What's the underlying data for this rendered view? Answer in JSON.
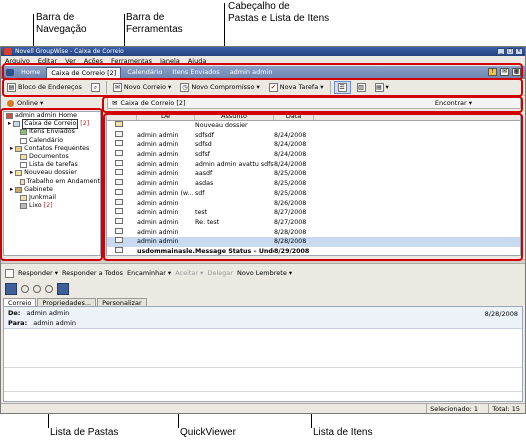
{
  "callouts": {
    "nav_bar": "Barra de\nNavegação",
    "toolbar": "Barra de\nFerramentas",
    "header": "Cabeçalho de\nPastas e Lista de Itens",
    "folder_list": "Lista de Pastas",
    "quickviewer": "QuickViewer",
    "item_list": "Lista de Itens"
  },
  "window": {
    "title": "Novell GroupWise - Caixa de Correio"
  },
  "menu": [
    "Arquivo",
    "Editar",
    "Ver",
    "Ações",
    "Ferramentas",
    "Janela",
    "Ajuda"
  ],
  "nav_tabs": [
    {
      "label": "Home",
      "active": false
    },
    {
      "label": "Caixa de Correio [2]",
      "active": true
    },
    {
      "label": "Calendário",
      "active": false
    },
    {
      "label": "Itens Enviados",
      "active": false
    },
    {
      "label": "admin admin",
      "active": false
    }
  ],
  "toolbar": {
    "address_book": "Bloco de Endereços",
    "new_mail": "Novo Correio ▾",
    "new_appointment": "Novo Compromisso ▾",
    "new_task": "Nova Tarefa ▾"
  },
  "location": {
    "online": "Online ▾",
    "breadcrumb": "Caixa de Correio [2]",
    "find": "Encontrar ▾"
  },
  "folders": [
    {
      "label": "admin admin Home",
      "indent": 0,
      "count": ""
    },
    {
      "label": "Caixa de Correio",
      "indent": 1,
      "count": "[2]",
      "selected": true
    },
    {
      "label": "Itens Enviados",
      "indent": 2,
      "count": ""
    },
    {
      "label": "Calendário",
      "indent": 2,
      "count": ""
    },
    {
      "label": "Contatos Frequentes",
      "indent": 2,
      "count": ""
    },
    {
      "label": "Documentos",
      "indent": 2,
      "count": ""
    },
    {
      "label": "Lista de tarefas",
      "indent": 2,
      "count": ""
    },
    {
      "label": "Nouveau dossier",
      "indent": 2,
      "count": ""
    },
    {
      "label": "Trabalho em Andament",
      "indent": 2,
      "count": ""
    },
    {
      "label": "Gabinete",
      "indent": 2,
      "count": ""
    },
    {
      "label": "Junkmail",
      "indent": 2,
      "count": ""
    },
    {
      "label": "Lixo",
      "indent": 2,
      "count": "[2]"
    }
  ],
  "list": {
    "headers": {
      "from": "De",
      "subject": "Assunto",
      "date": "Data"
    },
    "rows": [
      {
        "from": "",
        "subject": "Nouveau dossier",
        "date": ""
      },
      {
        "from": "admin admin",
        "subject": "sdfsdf",
        "date": "8/24/2008"
      },
      {
        "from": "admin admin",
        "subject": "sdfsd",
        "date": "8/24/2008"
      },
      {
        "from": "admin admin",
        "subject": "sdfsf",
        "date": "8/24/2008"
      },
      {
        "from": "admin admin",
        "subject": "admin admin avattu sdfsf",
        "date": "8/24/2008"
      },
      {
        "from": "admin admin",
        "subject": "aasdf",
        "date": "8/25/2008"
      },
      {
        "from": "admin admin",
        "subject": "asdas",
        "date": "8/25/2008"
      },
      {
        "from": "admin admin (w...",
        "subject": "sdf",
        "date": "8/25/2008"
      },
      {
        "from": "admin admin",
        "subject": "",
        "date": "8/26/2008"
      },
      {
        "from": "admin admin",
        "subject": "test",
        "date": "8/27/2008"
      },
      {
        "from": "admin admin",
        "subject": "Re: test",
        "date": "8/27/2008"
      },
      {
        "from": "admin admin",
        "subject": "",
        "date": "8/28/2008"
      },
      {
        "from": "admin admin",
        "subject": "",
        "date": "8/28/2008",
        "selected": true
      },
      {
        "from": "usdommainasle...",
        "subject": "Message Status – Undeli...",
        "date": "8/29/2008",
        "bold": true
      }
    ]
  },
  "quickviewer_toolbar": {
    "reply": "Responder ▾",
    "reply_all": "Responder a Todos",
    "forward": "Encaminhar ▾",
    "accept": "Aceitar ▾",
    "delegate": "Delegar",
    "new_reminder": "Novo Lembrete ▾"
  },
  "qv_tabs": [
    "Correio",
    "Propriedades...",
    "Personalizar"
  ],
  "message": {
    "from_label": "De:",
    "from_value": "admin admin",
    "to_label": "Para:",
    "to_value": "admin admin",
    "date": "8/28/2008"
  },
  "status": {
    "selected": "Selecionado: 1",
    "total": "Total: 15"
  }
}
